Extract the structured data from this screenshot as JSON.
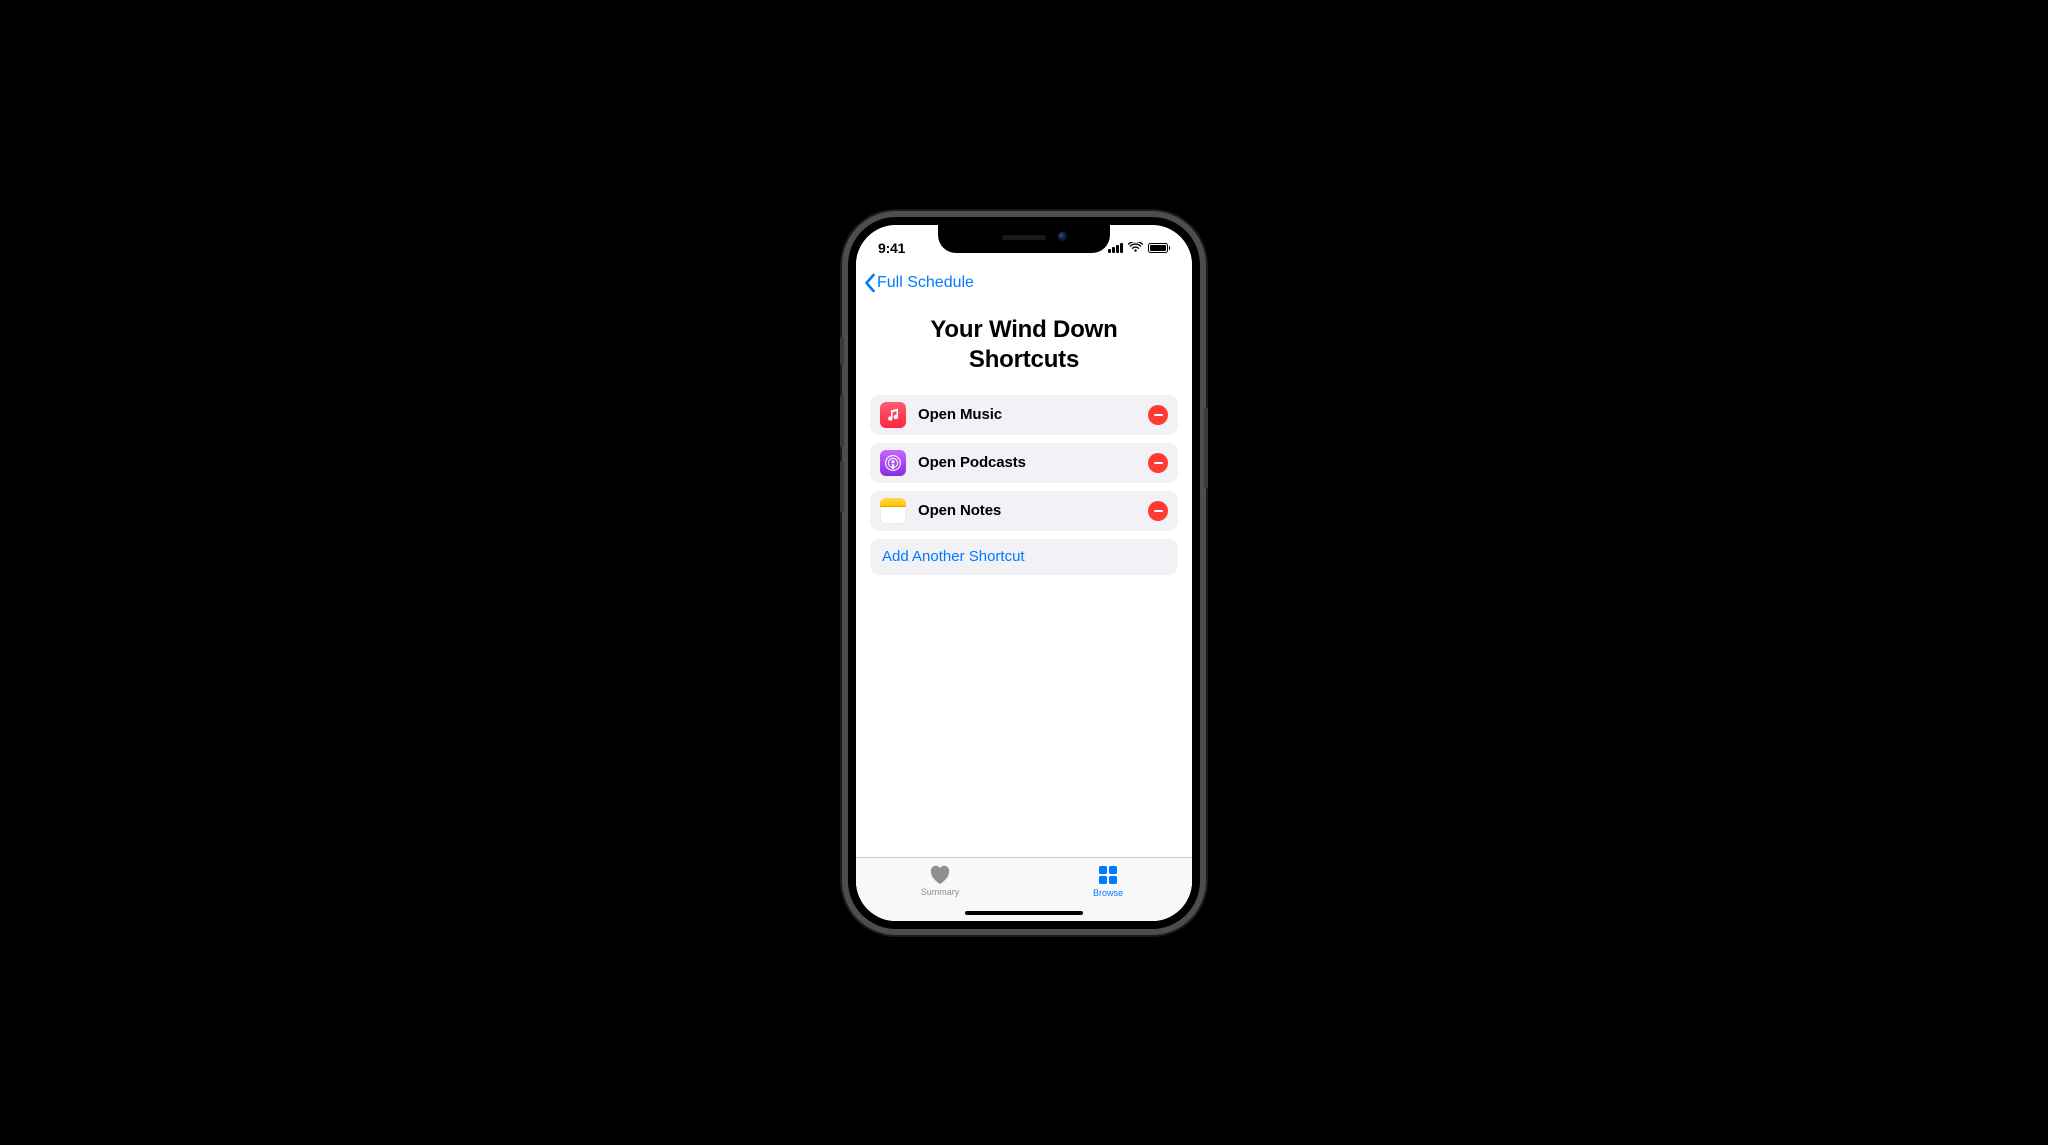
{
  "status": {
    "time": "9:41"
  },
  "nav": {
    "back_label": "Full Schedule"
  },
  "page": {
    "title": "Your Wind Down Shortcuts"
  },
  "shortcuts": [
    {
      "app": "music",
      "label": "Open Music"
    },
    {
      "app": "podcasts",
      "label": "Open Podcasts"
    },
    {
      "app": "notes",
      "label": "Open Notes"
    }
  ],
  "add_label": "Add Another Shortcut",
  "tabs": {
    "summary": "Summary",
    "browse": "Browse"
  },
  "colors": {
    "accent": "#007aff",
    "destructive": "#ff3b30",
    "row_bg": "#f2f2f6"
  }
}
